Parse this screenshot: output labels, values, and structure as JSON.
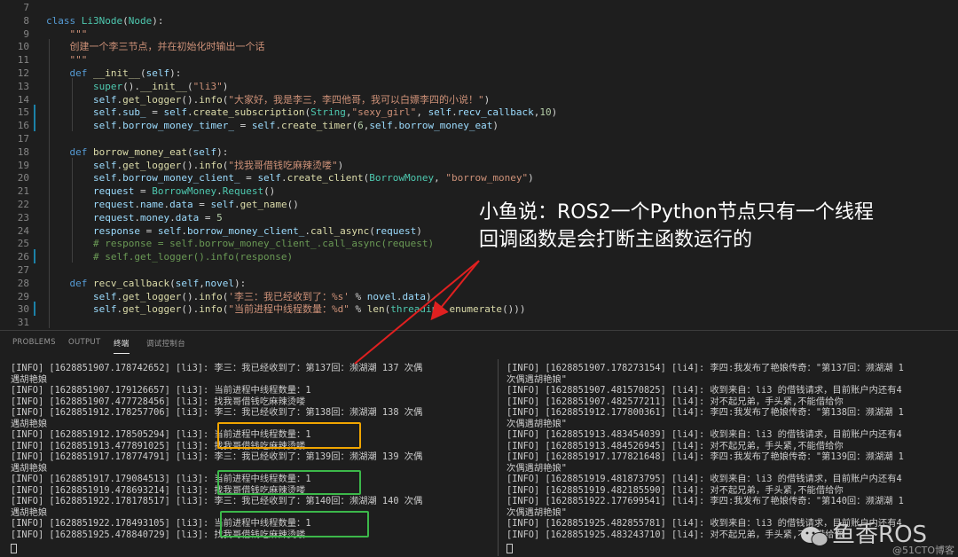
{
  "editor": {
    "lines": [
      {
        "n": "7",
        "html": ""
      },
      {
        "n": "8",
        "html": "<span class=\"kw\">class</span> <span class=\"cls\">Li3Node</span>(<span class=\"cls\">Node</span>):"
      },
      {
        "n": "9",
        "html": "    <span class=\"doc\">\"\"\"</span>"
      },
      {
        "n": "10",
        "html": "    <span class=\"doc\">创建一个李三节点，并在初始化时输出一个话</span>"
      },
      {
        "n": "11",
        "html": "    <span class=\"doc\">\"\"\"</span>"
      },
      {
        "n": "12",
        "html": "    <span class=\"kw\">def</span> <span class=\"fn\">__init__</span>(<span class=\"sf\">self</span>):"
      },
      {
        "n": "13",
        "html": "        <span class=\"cls\">super</span>().<span class=\"fn\">__init__</span>(<span class=\"str\">\"li3\"</span>)"
      },
      {
        "n": "14",
        "html": "        <span class=\"sf\">self</span>.<span class=\"fn\">get_logger</span>().<span class=\"fn\">info</span>(<span class=\"str\">\"大家好，我是李三，李四他哥，我可以白嫖李四的小说！\"</span>)"
      },
      {
        "n": "15",
        "html": "        <span class=\"sf\">self</span>.<span class=\"var\">sub_</span> = <span class=\"sf\">self</span>.<span class=\"fn\">create_subscription</span>(<span class=\"cls\">String</span>,<span class=\"str\">\"sexy_girl\"</span>, <span class=\"sf\">self</span>.<span class=\"var\">recv_callback</span>,<span class=\"num\">10</span>)"
      },
      {
        "n": "16",
        "html": "        <span class=\"sf\">self</span>.<span class=\"var\">borrow_money_timer_</span> = <span class=\"sf\">self</span>.<span class=\"fn\">create_timer</span>(<span class=\"num\">6</span>,<span class=\"sf\">self</span>.<span class=\"var\">borrow_money_eat</span>)"
      },
      {
        "n": "17",
        "html": ""
      },
      {
        "n": "18",
        "html": "    <span class=\"kw\">def</span> <span class=\"fn\">borrow_money_eat</span>(<span class=\"sf\">self</span>):"
      },
      {
        "n": "19",
        "html": "        <span class=\"sf\">self</span>.<span class=\"fn\">get_logger</span>().<span class=\"fn\">info</span>(<span class=\"str\">\"找我哥借钱吃麻辣烫喽\"</span>)"
      },
      {
        "n": "20",
        "html": "        <span class=\"sf\">self</span>.<span class=\"var\">borrow_money_client_</span> = <span class=\"sf\">self</span>.<span class=\"fn\">create_client</span>(<span class=\"cls\">BorrowMoney</span>, <span class=\"str\">\"borrow_money\"</span>)"
      },
      {
        "n": "21",
        "html": "        <span class=\"var\">request</span> = <span class=\"cls\">BorrowMoney</span>.<span class=\"cls\">Request</span>()"
      },
      {
        "n": "22",
        "html": "        <span class=\"var\">request</span>.<span class=\"var\">name</span>.<span class=\"var\">data</span> = <span class=\"sf\">self</span>.<span class=\"fn\">get_name</span>()"
      },
      {
        "n": "23",
        "html": "        <span class=\"var\">request</span>.<span class=\"var\">money</span>.<span class=\"var\">data</span> = <span class=\"num\">5</span>"
      },
      {
        "n": "24",
        "html": "        <span class=\"var\">response</span> = <span class=\"sf\">self</span>.<span class=\"var\">borrow_money_client_</span>.<span class=\"fn\">call_async</span>(<span class=\"var\">request</span>)"
      },
      {
        "n": "25",
        "html": "        <span class=\"cm\"># response = self.borrow_money_client_.call_async(request)</span>"
      },
      {
        "n": "26",
        "html": "        <span class=\"cm\"># self.get_logger().info(response)</span>"
      },
      {
        "n": "27",
        "html": ""
      },
      {
        "n": "28",
        "html": "    <span class=\"kw\">def</span> <span class=\"fn\">recv_callback</span>(<span class=\"sf\">self</span>,<span class=\"var\">novel</span>):"
      },
      {
        "n": "29",
        "html": "        <span class=\"sf\">self</span>.<span class=\"fn\">get_logger</span>().<span class=\"fn\">info</span>(<span class=\"str\">'李三：我已经收到了：%s'</span> % <span class=\"var\">novel</span>.<span class=\"var\">data</span>)"
      },
      {
        "n": "30",
        "html": "        <span class=\"sf\">self</span>.<span class=\"fn\">get_logger</span>().<span class=\"fn\">info</span>(<span class=\"str\">\"当前进程中线程数量：%d\"</span> % <span class=\"fn\">len</span>(<span class=\"cls\">threading</span>.<span class=\"fn\">enumerate</span>()))"
      },
      {
        "n": "31",
        "html": ""
      }
    ]
  },
  "caption": {
    "line1": "小鱼说：ROS2一个Python节点只有一个线程",
    "line2": "回调函数是会打断主函数运行的"
  },
  "panel": {
    "tabs": [
      "PROBLEMS",
      "OUTPUT",
      "终端",
      "调试控制台"
    ],
    "active_tab": "终端"
  },
  "terminal_left": [
    "[INFO] [1628851907.178742652] [li3]: 李三：我已经收到了：第137回：濒湖潮 137 次偶",
    "遇胡艳娘",
    "[INFO] [1628851907.179126657] [li3]: 当前进程中线程数量：1",
    "[INFO] [1628851907.477728456] [li3]: 找我哥借钱吃麻辣烫喽",
    "[INFO] [1628851912.178257706] [li3]: 李三：我已经收到了：第138回：濒湖潮 138 次偶",
    "遇胡艳娘",
    "[INFO] [1628851912.178505294] [li3]: 当前进程中线程数量：1",
    "[INFO] [1628851913.477891025] [li3]: 找我哥借钱吃麻辣烫喽",
    "[INFO] [1628851917.178774791] [li3]: 李三：我已经收到了：第139回：濒湖潮 139 次偶",
    "遇胡艳娘",
    "[INFO] [1628851917.179084513] [li3]: 当前进程中线程数量：1",
    "[INFO] [1628851919.478693214] [li3]: 找我哥借钱吃麻辣烫喽",
    "[INFO] [1628851922.178178517] [li3]: 李三：我已经收到了：第140回：濒湖潮 140 次偶",
    "遇胡艳娘",
    "[INFO] [1628851922.178493105] [li3]: 当前进程中线程数量：1",
    "[INFO] [1628851925.478840729] [li3]: 找我哥借钱吃麻辣烫喽"
  ],
  "terminal_right": [
    "[INFO] [1628851907.178273154] [li4]: 李四:我发布了艳娘传奇：\"第137回：濒湖潮 1",
    "次偶遇胡艳娘\"",
    "[INFO] [1628851907.481570825] [li4]: 收到来自：li3 的借钱请求，目前账户内还有4",
    "[INFO] [1628851907.482577211] [li4]: 对不起兄弟，手头紧,不能借给你",
    "[INFO] [1628851912.177800361] [li4]: 李四:我发布了艳娘传奇：\"第138回：濒湖潮 1",
    "次偶遇胡艳娘\"",
    "[INFO] [1628851913.483454039] [li4]: 收到来自：li3 的借钱请求，目前账户内还有4",
    "[INFO] [1628851913.484526945] [li4]: 对不起兄弟，手头紧,不能借给你",
    "[INFO] [1628851917.177821648] [li4]: 李四:我发布了艳娘传奇：\"第139回：濒湖潮 1",
    "次偶遇胡艳娘\"",
    "[INFO] [1628851919.481873795] [li4]: 收到来自：li3 的借钱请求，目前账户内还有4",
    "[INFO] [1628851919.482185590] [li4]: 对不起兄弟，手头紧,不能借给你",
    "[INFO] [1628851922.177699541] [li4]: 李四:我发布了艳娘传奇：\"第140回：濒湖潮 1",
    "次偶遇胡艳娘\"",
    "[INFO] [1628851925.482855781] [li4]: 收到来自：li3 的借钱请求，目前账户内还有4",
    "[INFO] [1628851925.483243710] [li4]: 对不起兄弟，手头紧,不能借给你"
  ],
  "watermark": {
    "title": "鱼香ROS",
    "subtitle": "@51CTO博客"
  },
  "colors": {
    "annotation_arrow": "#e02020",
    "orange_box": "#f0a500",
    "green_box": "#3cb84a"
  }
}
